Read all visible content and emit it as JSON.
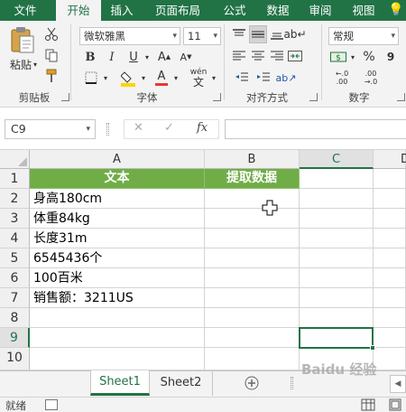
{
  "ribbon_tabs": [
    {
      "label": "文件",
      "active": false
    },
    {
      "label": "开始",
      "active": true
    },
    {
      "label": "插入",
      "active": false
    },
    {
      "label": "页面布局",
      "active": false
    },
    {
      "label": "公式",
      "active": false
    },
    {
      "label": "数据",
      "active": false
    },
    {
      "label": "审阅",
      "active": false
    },
    {
      "label": "视图",
      "active": false
    }
  ],
  "ribbon": {
    "clipboard": {
      "paste_label": "粘贴",
      "group_label": "剪贴板"
    },
    "font": {
      "name": "微软雅黑",
      "size": "11",
      "group_label": "字体",
      "bold": "B",
      "italic": "I",
      "underline": "U",
      "grow": "A",
      "shrink": "A",
      "phonetic": "wén"
    },
    "alignment": {
      "group_label": "对齐方式"
    },
    "number": {
      "format": "常规",
      "group_label": "数字",
      "percent": "%",
      "comma": "9",
      "currency_symbol": "$",
      "inc_decimal": "+.0\n.00",
      "dec_decimal": ".00\n+.0"
    },
    "colors": {
      "brand": "#217346",
      "fill_accent": "#ffd400",
      "font_accent": "#e53935"
    }
  },
  "formula_bar": {
    "name_box": "C9",
    "cancel": "✕",
    "enter": "✓",
    "fx": "fx",
    "value": ""
  },
  "grid": {
    "columns": [
      "A",
      "B",
      "C",
      "D"
    ],
    "rows": [
      "1",
      "2",
      "3",
      "4",
      "5",
      "6",
      "7",
      "8",
      "9",
      "10"
    ],
    "header_row": {
      "A": "文本",
      "B": "提取数据"
    },
    "column_a_values": [
      "身高180cm",
      "体重84kg",
      "长度31m",
      "6545436个",
      "100百米",
      "销售额：3211US"
    ],
    "selected_cell": "C9",
    "header_fill": "#70ad47"
  },
  "sheets": [
    {
      "name": "Sheet1",
      "active": true
    },
    {
      "name": "Sheet2",
      "active": false
    }
  ],
  "status": {
    "mode": "就绪"
  },
  "watermark": "Baidu 经验"
}
